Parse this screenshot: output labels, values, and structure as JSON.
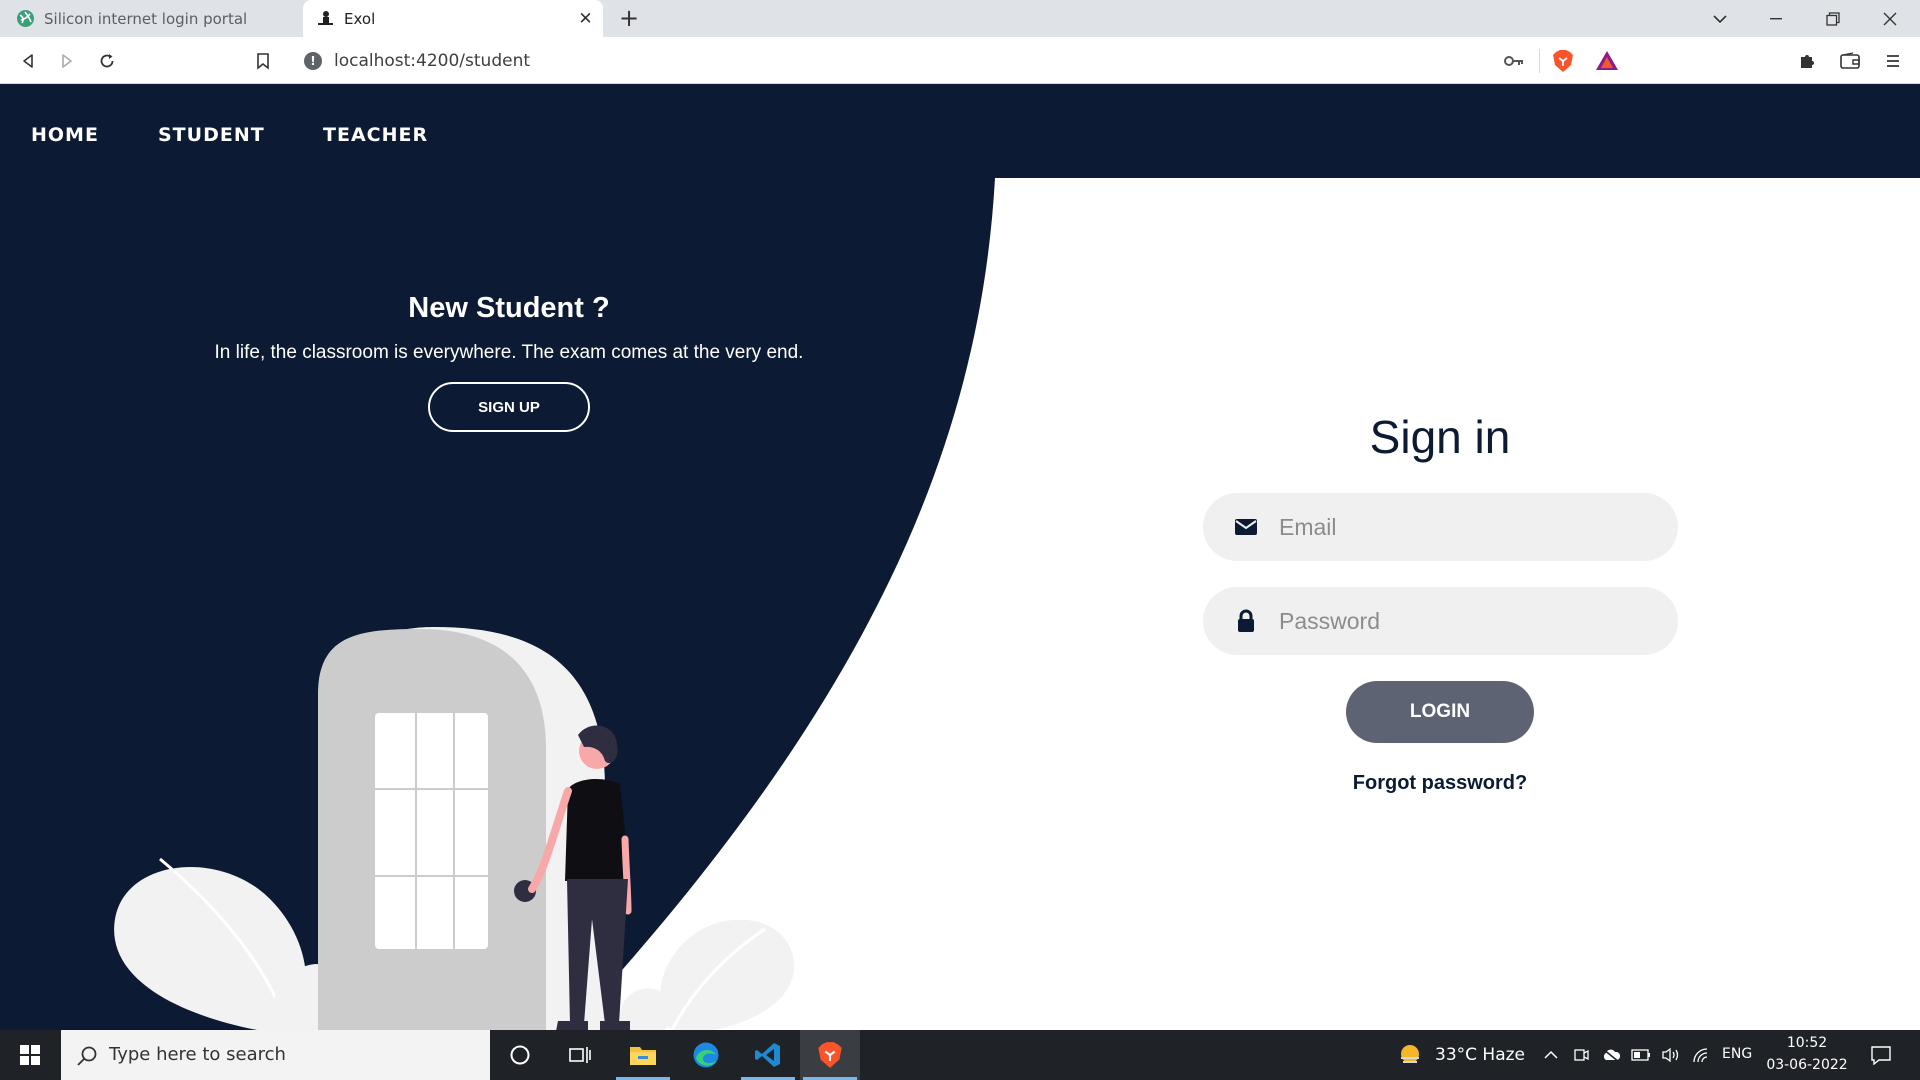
{
  "browser": {
    "tabs": [
      {
        "title": "Silicon internet login portal",
        "active": false
      },
      {
        "title": "Exol",
        "active": true
      }
    ],
    "url": "localhost:4200/student"
  },
  "nav": {
    "items": [
      {
        "label": "HOME"
      },
      {
        "label": "STUDENT"
      },
      {
        "label": "TEACHER"
      }
    ]
  },
  "promo": {
    "title": "New Student ?",
    "text": "In life, the classroom is everywhere. The exam comes at the very end.",
    "signup_label": "SIGN UP"
  },
  "signin": {
    "title": "Sign in",
    "email_placeholder": "Email",
    "password_placeholder": "Password",
    "login_label": "LOGIN",
    "forgot_label": "Forgot password?"
  },
  "taskbar": {
    "search_placeholder": "Type here to search",
    "weather": "33°C  Haze",
    "language": "ENG",
    "time": "10:52",
    "date": "03-06-2022"
  },
  "colors": {
    "navy": "#0c1a33",
    "button_gray": "#5d6373",
    "field_bg": "#f0f0f0"
  }
}
